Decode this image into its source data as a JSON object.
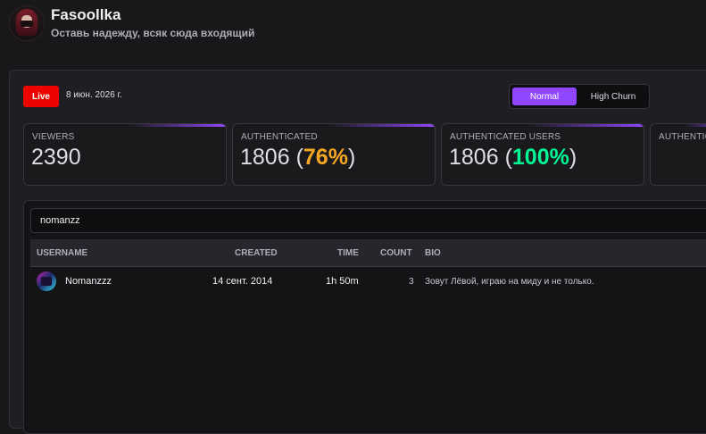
{
  "channel": {
    "name": "Fasoollka",
    "description": "Оставь надежду, всяк сюда входящий"
  },
  "live_badge": "Live",
  "date": "8 июн. 2026 г.",
  "mode_toggle": {
    "normal_label": "Normal",
    "high_churn_label": "High Churn",
    "selected": "Normal"
  },
  "stats": [
    {
      "label": "VIEWERS",
      "value": "2390",
      "percent": ""
    },
    {
      "label": "AUTHENTICATED",
      "value": "1806",
      "percent": "76%"
    },
    {
      "label": "AUTHENTICATED USERS",
      "value": "1806",
      "percent": "100%"
    },
    {
      "label": "AUTHENTIC"
    }
  ],
  "search": {
    "value": "nomanzz"
  },
  "table": {
    "columns": {
      "username": "USERNAME",
      "created": "CREATED",
      "time": "TIME",
      "count": "COUNT",
      "bio": "BIO"
    },
    "rows": [
      {
        "username": "Nomanzzz",
        "created": "14 сент. 2014",
        "time": "1h 50m",
        "count": "3",
        "bio": "Зовут Лёвой, играю на миду и не только."
      }
    ]
  },
  "colors": {
    "accent": "#9147ff",
    "live": "#eb0400",
    "percent_orange": "#f5a623",
    "percent_green": "#00f593"
  }
}
